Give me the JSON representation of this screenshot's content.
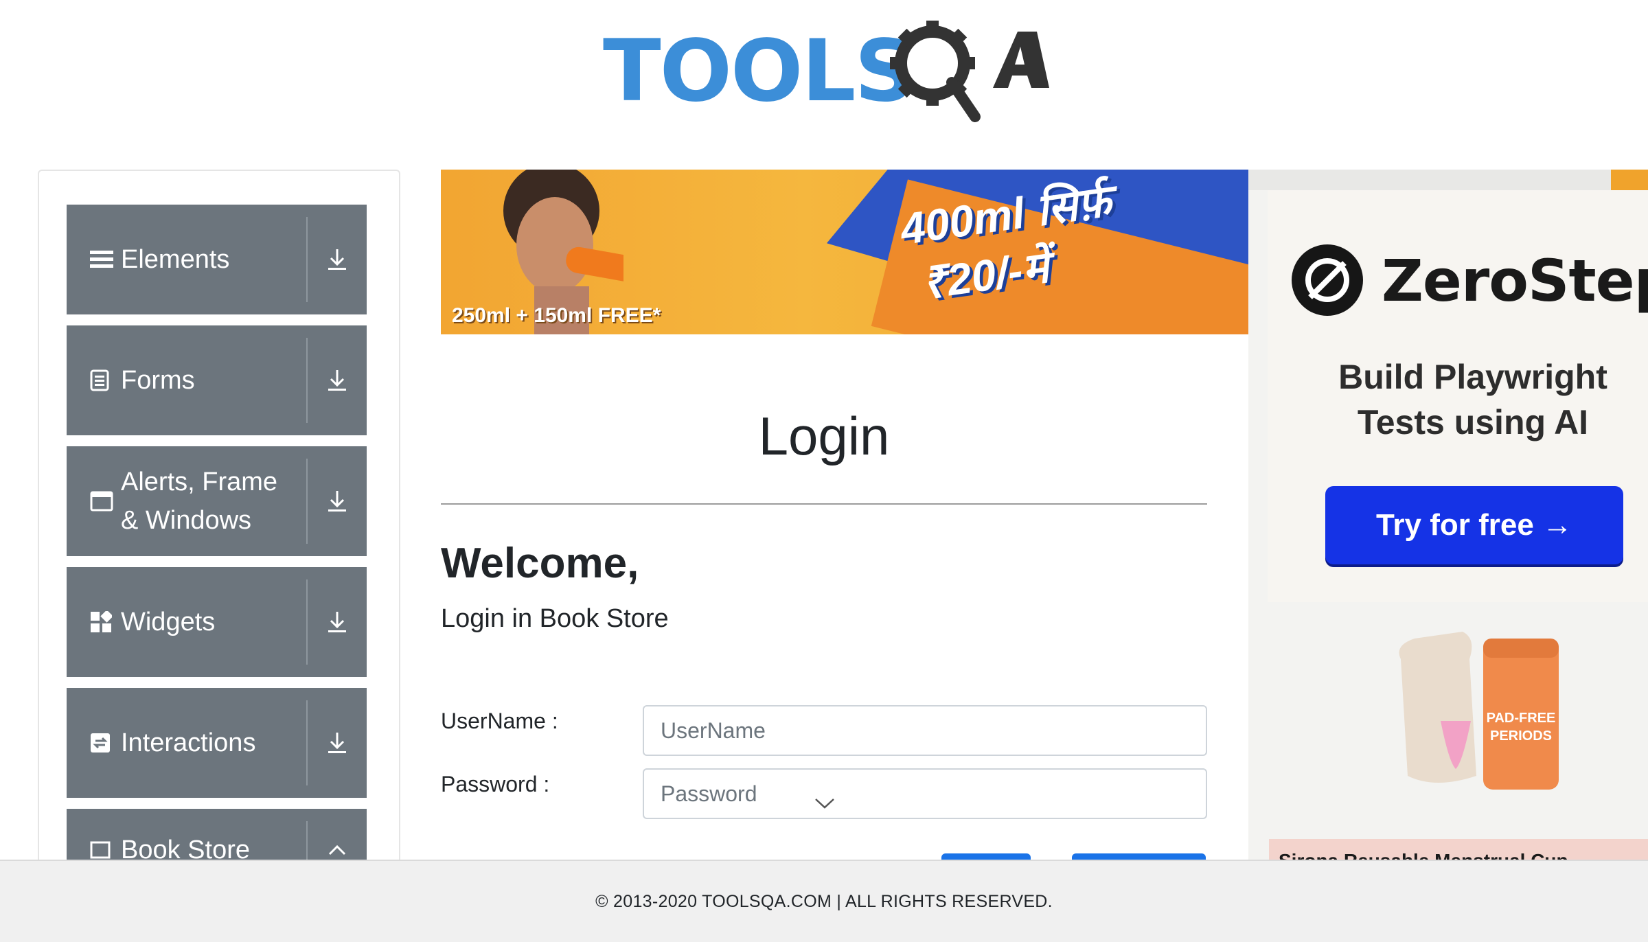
{
  "header": {
    "logo_text": "TOOLS",
    "logo_suffix": "QA"
  },
  "sidebar": {
    "groups": [
      {
        "label": "Elements",
        "icon": "list-icon"
      },
      {
        "label": "Forms",
        "icon": "form-icon"
      },
      {
        "label": "Alerts, Frame & Windows",
        "icon": "window-icon"
      },
      {
        "label": "Widgets",
        "icon": "widgets-icon"
      },
      {
        "label": "Interactions",
        "icon": "interactions-icon"
      },
      {
        "label": "Book Store",
        "icon": "book-icon"
      }
    ]
  },
  "banner_ad": {
    "headline_1": "400ml सिर्फ़",
    "headline_2": "₹20/-में",
    "offer": "250ml + 150ml FREE*"
  },
  "main": {
    "title": "Login",
    "welcome": "Welcome,",
    "subtitle": "Login in Book Store",
    "username": {
      "label": "UserName :",
      "placeholder": "UserName"
    },
    "password": {
      "label": "Password :",
      "placeholder": "Password"
    }
  },
  "right_ad": {
    "brand": "ZeroStep",
    "line_1": "Build Playwright",
    "line_2": "Tests using AI",
    "cta": "Try for free →",
    "product_title": "Sirona Reusable Menstrual Cup",
    "product_box_text": "PAD-FREE PERIODS"
  },
  "footer": {
    "copyright": "© 2013-2020 TOOLSQA.COM | ALL RIGHTS RESERVED."
  },
  "colors": {
    "sidebar_bg": "#6c757d",
    "brand_blue": "#3c8ed8",
    "cta_blue": "#1533e6",
    "footer_bg": "#f0f0f0"
  }
}
